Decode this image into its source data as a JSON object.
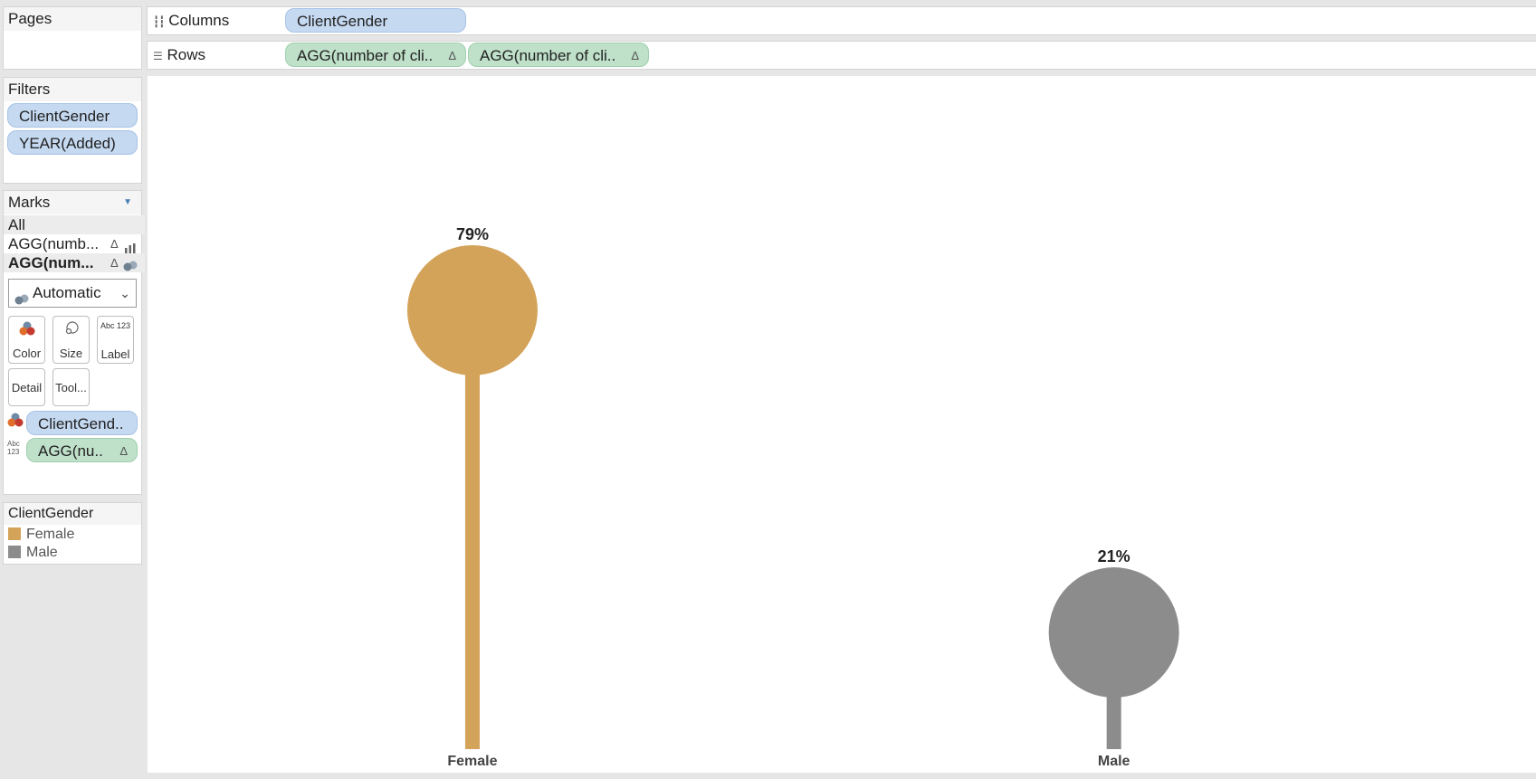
{
  "pages": {
    "title": "Pages"
  },
  "columns": {
    "label": "Columns",
    "pills": [
      {
        "text": "ClientGender",
        "kind": "dimension"
      }
    ]
  },
  "rows": {
    "label": "Rows",
    "pills": [
      {
        "text": "AGG(number of cli..",
        "kind": "measure",
        "delta": "Δ"
      },
      {
        "text": "AGG(number of cli..",
        "kind": "measure",
        "delta": "Δ"
      }
    ]
  },
  "filters": {
    "title": "Filters",
    "items": [
      "ClientGender",
      "YEAR(Added)"
    ]
  },
  "marks": {
    "title": "Marks",
    "all_label": "All",
    "layers": [
      {
        "label": "AGG(numb...",
        "delta": "Δ",
        "icon": "bar-chart-icon"
      },
      {
        "label": "AGG(num...",
        "delta": "Δ",
        "icon": "circles-icon"
      }
    ],
    "mark_type": "Automatic",
    "buttons": {
      "color": "Color",
      "size": "Size",
      "label": "Label",
      "detail": "Detail",
      "tooltip": "Tool..."
    },
    "label_icon_text": "Abc 123",
    "pills": [
      {
        "text": "ClientGend..",
        "kind": "dimension",
        "encoding": "color"
      },
      {
        "text": "AGG(nu..",
        "kind": "measure",
        "encoding": "label",
        "delta": "Δ"
      }
    ]
  },
  "legend": {
    "title": "ClientGender",
    "items": [
      {
        "label": "Female",
        "color": "#d4a35a"
      },
      {
        "label": "Male",
        "color": "#8c8c8c"
      }
    ]
  },
  "chart_data": {
    "type": "bar",
    "categories": [
      "Female",
      "Male"
    ],
    "values": [
      79,
      21
    ],
    "value_labels": [
      "79%",
      "21%"
    ],
    "colors": [
      "#d4a35a",
      "#8c8c8c"
    ],
    "ylim": [
      0,
      100
    ],
    "title": "",
    "xlabel": "",
    "ylabel": "",
    "grid": false
  }
}
